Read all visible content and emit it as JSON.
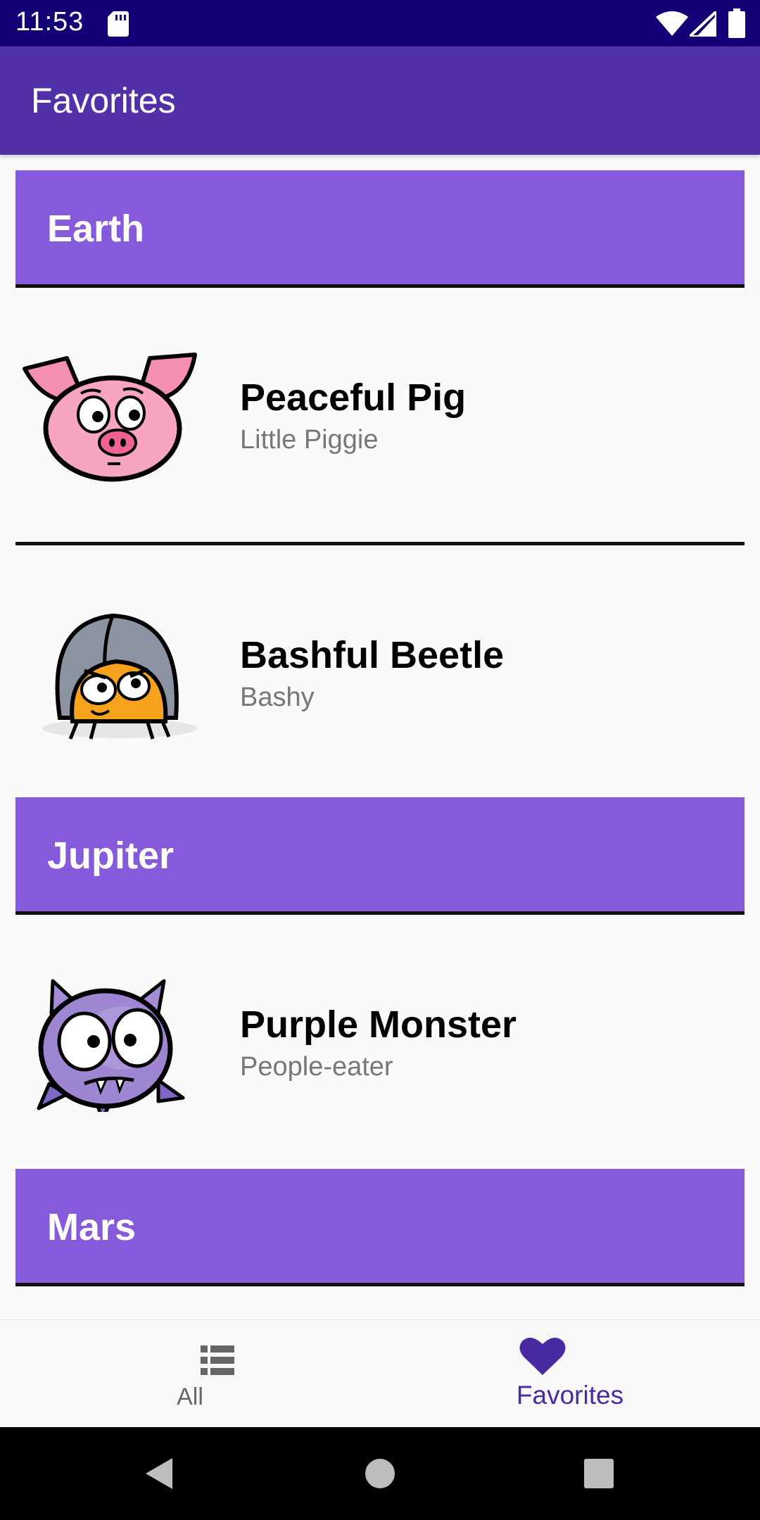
{
  "status_bar": {
    "time": "11:53"
  },
  "app_bar": {
    "title": "Favorites"
  },
  "sections": [
    {
      "title": "Earth"
    },
    {
      "title": "Jupiter"
    },
    {
      "title": "Mars"
    }
  ],
  "items": [
    {
      "name": "Peaceful Pig",
      "nickname": "Little Piggie",
      "icon": "pig-avatar"
    },
    {
      "name": "Bashful Beetle",
      "nickname": "Bashy",
      "icon": "beetle-avatar"
    },
    {
      "name": "Purple Monster",
      "nickname": "People-eater",
      "icon": "monster-avatar"
    }
  ],
  "bottom_nav": {
    "tabs": [
      {
        "label": "All",
        "icon": "list-icon",
        "selected": false
      },
      {
        "label": "Favorites",
        "icon": "heart-icon",
        "selected": true
      }
    ]
  },
  "colors": {
    "status_bar": "#130277",
    "app_bar": "#5231a8",
    "section_header": "#855bdb",
    "selected_tab": "#4a2aa2"
  }
}
